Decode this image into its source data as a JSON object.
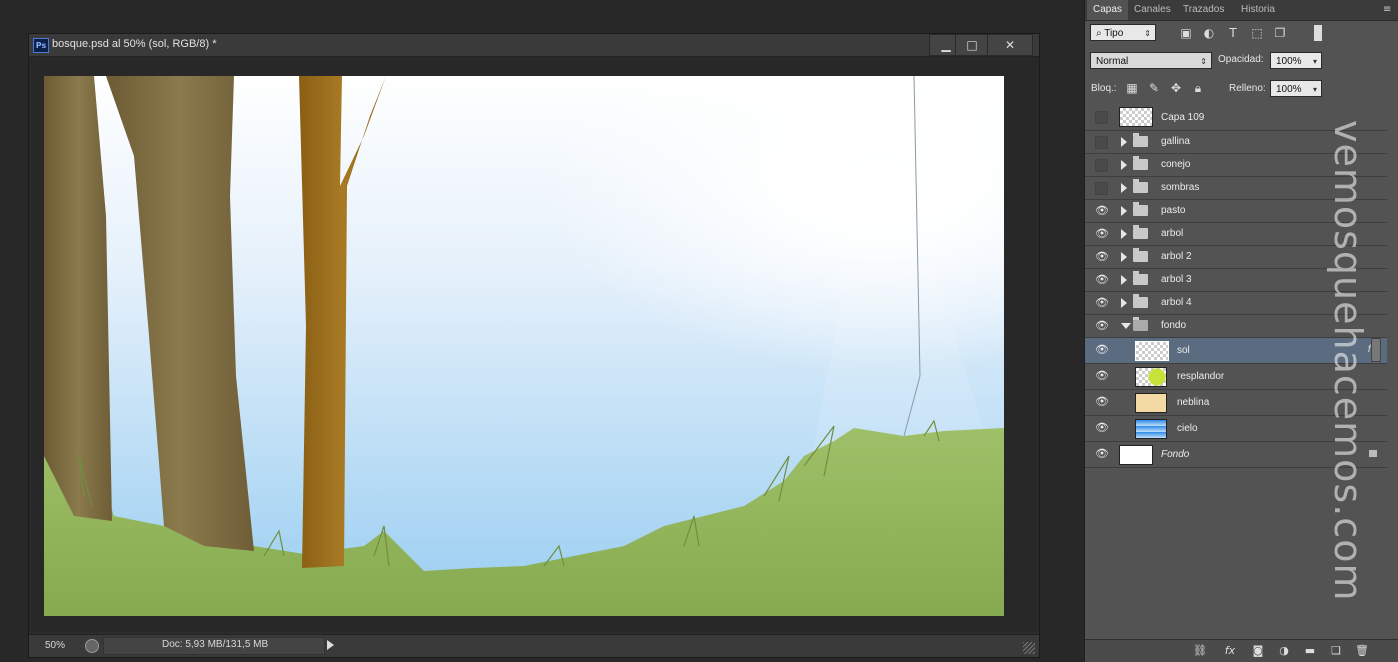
{
  "document": {
    "title": "bosque.psd al 50% (sol, RGB/8) *",
    "ps_icon": "Ps",
    "zoom": "50%",
    "doc_info": "Doc: 5,93 MB/131,5 MB",
    "window_buttons": {
      "minimize": "▁",
      "maximize": "□",
      "close": "✕"
    }
  },
  "panel": {
    "tabs": [
      {
        "label": "Capas",
        "active": true
      },
      {
        "label": "Canales",
        "active": false
      },
      {
        "label": "Trazados",
        "active": false
      },
      {
        "label": "Historia",
        "active": false
      }
    ],
    "filter_kind": "Tipo",
    "blend_mode": "Normal",
    "opacity_label": "Opacidad:",
    "opacity_value": "100%",
    "lock_label": "Bloq.:",
    "fill_label": "Relleno:",
    "fill_value": "100%",
    "layers": [
      {
        "name": "Capa 109",
        "type": "layer",
        "visible": false
      },
      {
        "name": "gallina",
        "type": "group",
        "visible": false
      },
      {
        "name": "conejo",
        "type": "group",
        "visible": false
      },
      {
        "name": "sombras",
        "type": "group",
        "visible": false
      },
      {
        "name": "pasto",
        "type": "group",
        "visible": true
      },
      {
        "name": "arbol",
        "type": "group",
        "visible": true
      },
      {
        "name": "arbol 2",
        "type": "group",
        "visible": true
      },
      {
        "name": "arbol 3",
        "type": "group",
        "visible": true
      },
      {
        "name": "arbol 4",
        "type": "group",
        "visible": true
      },
      {
        "name": "fondo",
        "type": "group-open",
        "visible": true
      },
      {
        "name": "sol",
        "type": "child",
        "visible": true,
        "selected": true,
        "fx": "fx"
      },
      {
        "name": "resplandor",
        "type": "child",
        "visible": true
      },
      {
        "name": "neblina",
        "type": "child",
        "visible": true
      },
      {
        "name": "cielo",
        "type": "child",
        "visible": true
      },
      {
        "name": "Fondo",
        "type": "background",
        "visible": true,
        "locked": true
      }
    ]
  },
  "watermark": "vemosquehacemos.com",
  "colors": {
    "sky_top": "#ffffff",
    "sky_bottom": "#9fd0f2",
    "grass": "#8fb35a",
    "trunk_dark": "#7c6a42",
    "trunk_orange": "#a0711d"
  }
}
